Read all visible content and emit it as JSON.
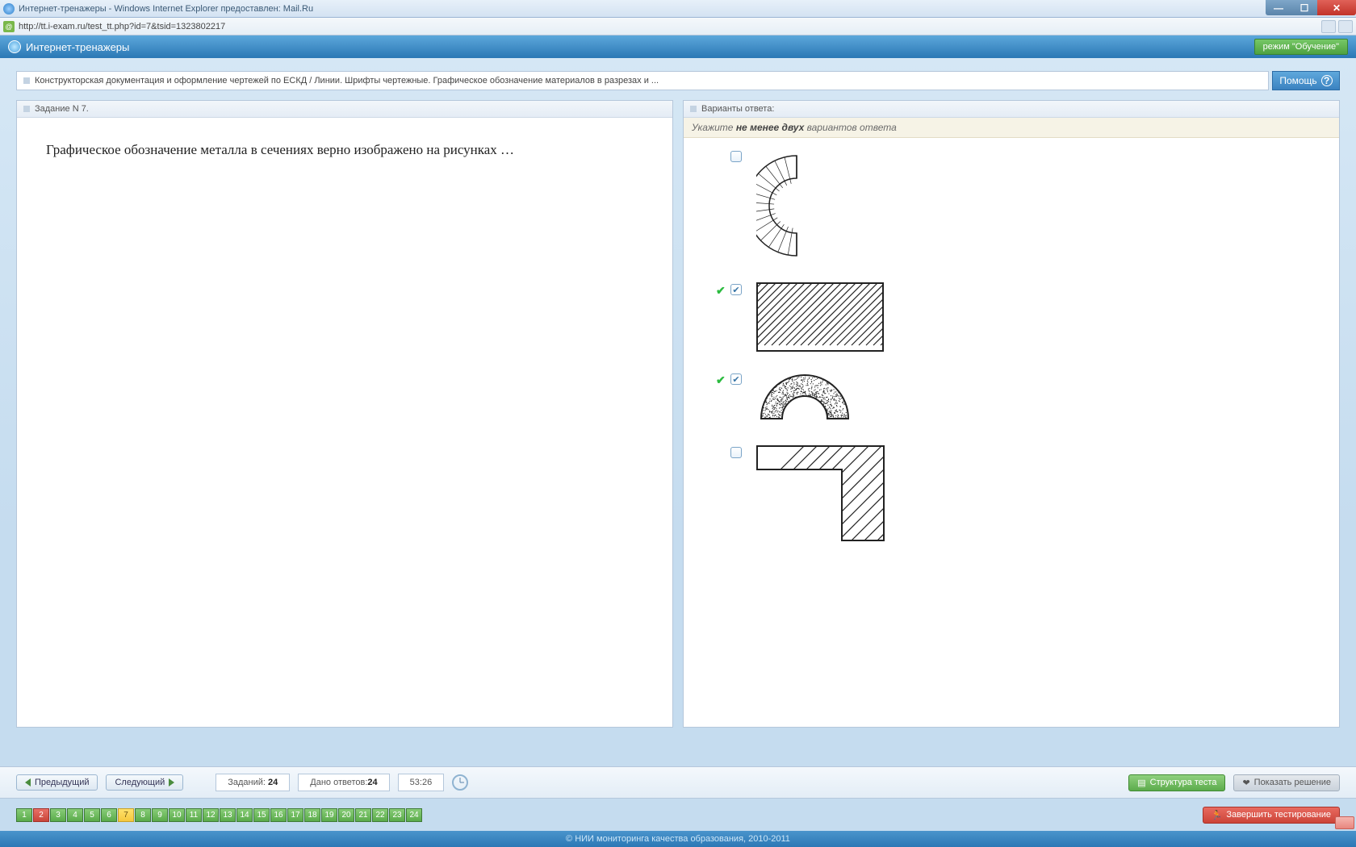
{
  "window": {
    "title": "Интернет-тренажеры - Windows Internet Explorer предоставлен: Mail.Ru",
    "url": "http://tt.i-exam.ru/test_tt.php?id=7&tsid=1323802217"
  },
  "app": {
    "title": "Интернет-тренажеры",
    "mode": "режим \"Обучение\""
  },
  "breadcrumb": "Конструкторская документация и оформление чертежей по ЕСКД / Линии. Шрифты чертежные. Графическое обозначение материалов в разрезах и ...",
  "help_label": "Помощь",
  "question": {
    "header": "Задание N 7.",
    "text": "Графическое обозначение металла в сечениях верно изображено на рисунках …"
  },
  "answers": {
    "header": "Варианты ответа:",
    "hint_prefix": "Укажите ",
    "hint_bold": "не менее двух",
    "hint_suffix": " вариантов ответа",
    "options": [
      {
        "id": "opt1",
        "checked": false,
        "correct": false,
        "shape": "c-shape"
      },
      {
        "id": "opt2",
        "checked": true,
        "correct": true,
        "shape": "rect-hatch"
      },
      {
        "id": "opt3",
        "checked": true,
        "correct": true,
        "shape": "arch-dotted"
      },
      {
        "id": "opt4",
        "checked": false,
        "correct": false,
        "shape": "l-hatch"
      }
    ]
  },
  "nav": {
    "prev": "Предыдущий",
    "next": "Следующий",
    "tasks_label": "Заданий: ",
    "tasks_count": "24",
    "answered_label": "Дано ответов:",
    "answered_count": "24",
    "timer": "53:26",
    "structure": "Структура теста",
    "show_solution": "Показать решение",
    "finish": "Завершить тестирование"
  },
  "pager": {
    "total": 24,
    "active": 7,
    "red": [
      2
    ]
  },
  "footer": "© НИИ мониторинга качества образования, 2010-2011"
}
